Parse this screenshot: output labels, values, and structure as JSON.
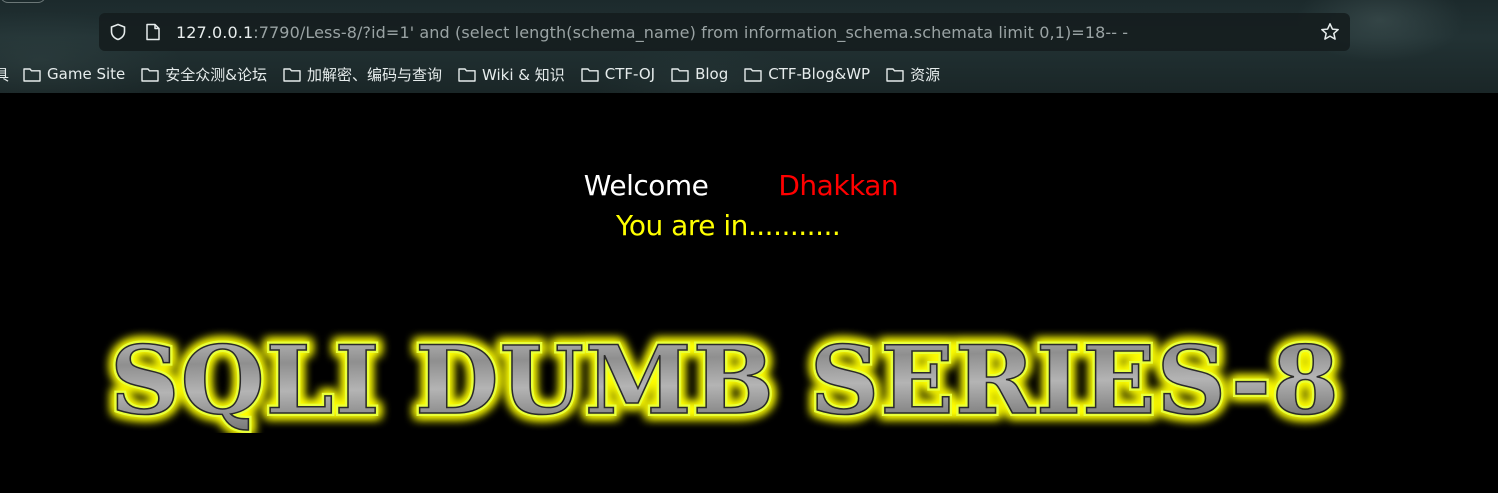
{
  "browser": {
    "address_bar": {
      "url_host": "127.0.0.1",
      "url_rest": ":7790/Less-8/?id=1' and (select length(schema_name) from information_schema.schemata limit 0,1)=18-- -"
    },
    "bookmarks": {
      "cut_item": "具",
      "items": [
        {
          "label": "Game Site"
        },
        {
          "label": "安全众测&论坛"
        },
        {
          "label": "加解密、编码与查询"
        },
        {
          "label": "Wiki & 知识"
        },
        {
          "label": "CTF-OJ"
        },
        {
          "label": "Blog"
        },
        {
          "label": "CTF-Blog&WP"
        },
        {
          "label": "资源"
        }
      ]
    }
  },
  "page": {
    "welcome_word": "Welcome",
    "welcome_name": "Dhakkan",
    "result_message": "You are in...........",
    "banner_text": "SQLI DUMB SERIES-8",
    "colors": {
      "background": "#000000",
      "welcome_word": "#ffffff",
      "welcome_name": "#ff0000",
      "result_message": "#ffff00",
      "banner_glow": "#ffff00",
      "banner_fill": "#9a9a9a"
    }
  }
}
